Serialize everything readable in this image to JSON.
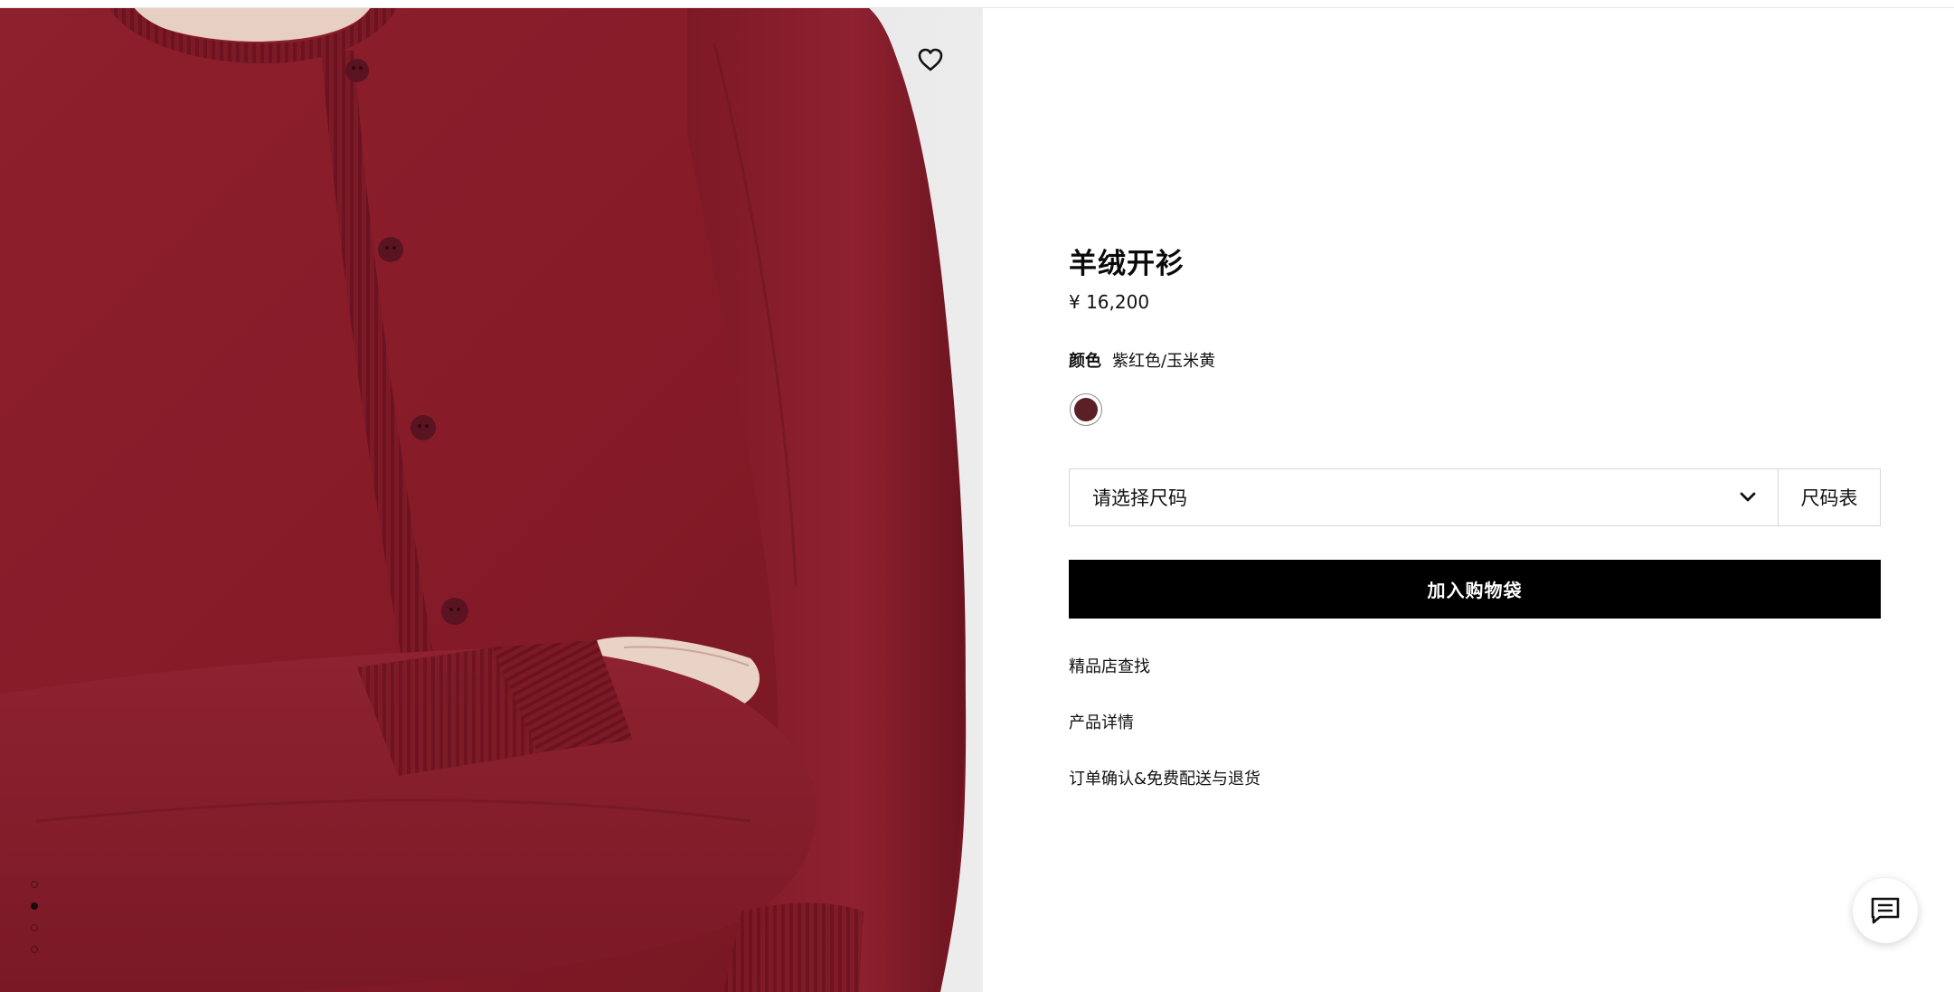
{
  "product": {
    "title": "羊绒开衫",
    "price": "¥ 16,200",
    "color_label": "颜色",
    "color_value": "紫红色/玉米黄",
    "swatch_color": "#5b1f26"
  },
  "size": {
    "select_placeholder": "请选择尺码",
    "guide_label": "尺码表"
  },
  "actions": {
    "add_to_bag": "加入购物袋"
  },
  "links": {
    "store_finder": "精品店查找",
    "product_details": "产品详情",
    "shipping_returns": "订单确认&免费配送与退货"
  },
  "gallery": {
    "dot_count": 4,
    "active_dot": 1
  },
  "icons": {
    "wishlist": "heart-icon",
    "dropdown": "chevron-down-icon",
    "chat": "chat-icon"
  },
  "colors": {
    "sweater": "#8b1e2b",
    "button_bg": "#000000",
    "background": "#ffffff"
  }
}
